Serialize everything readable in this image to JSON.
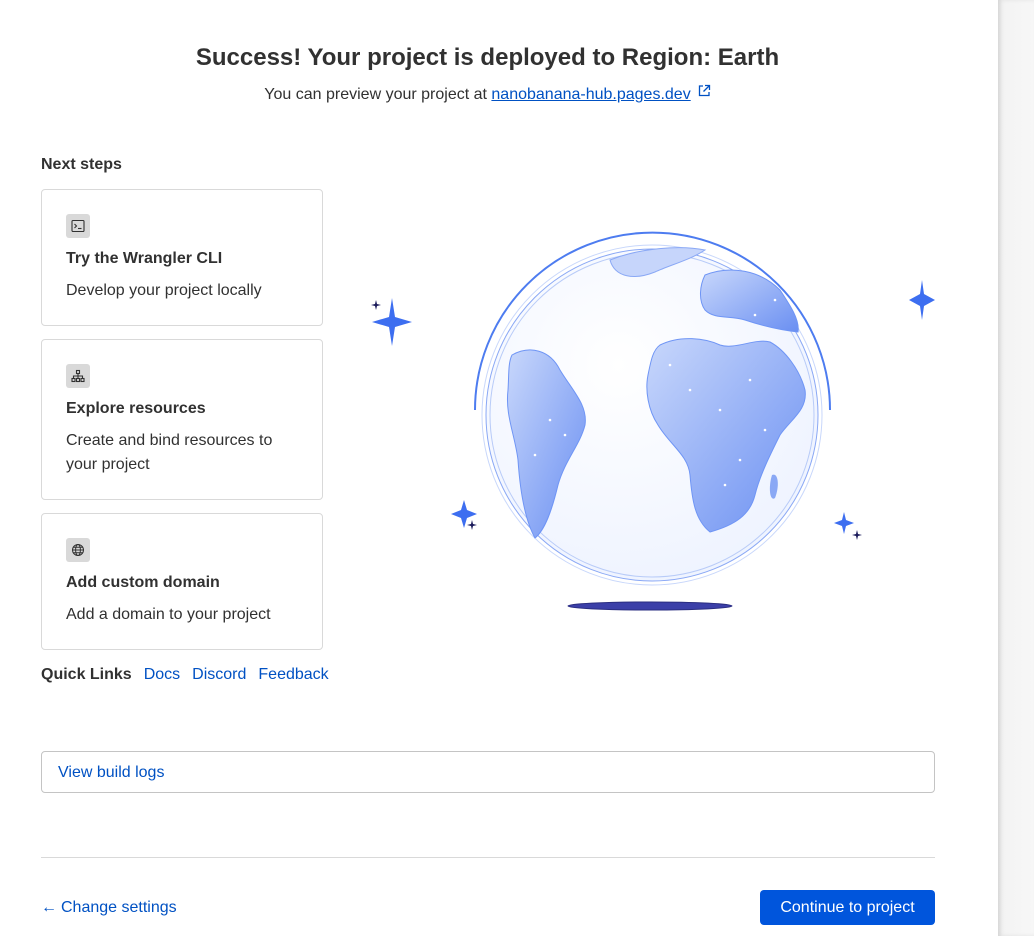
{
  "header": {
    "title": "Success! Your project is deployed to Region: Earth",
    "preview_prefix": "You can preview your project at",
    "preview_link": "nanobanana-hub.pages.dev"
  },
  "next_steps": {
    "label": "Next steps",
    "cards": [
      {
        "icon": "terminal-icon",
        "title": "Try the Wrangler CLI",
        "desc": "Develop your project locally"
      },
      {
        "icon": "sitemap-icon",
        "title": "Explore resources",
        "desc": "Create and bind resources to your project"
      },
      {
        "icon": "globe-icon",
        "title": "Add custom domain",
        "desc": "Add a domain to your project"
      }
    ]
  },
  "quick_links": {
    "label": "Quick Links",
    "items": [
      "Docs",
      "Discord",
      "Feedback"
    ]
  },
  "build_logs": {
    "label": "View build logs"
  },
  "footer": {
    "back_label": "Change settings",
    "continue_label": "Continue to project"
  },
  "colors": {
    "accent": "#0055dc",
    "link": "#0051c3",
    "globe": "#6f95f5"
  }
}
